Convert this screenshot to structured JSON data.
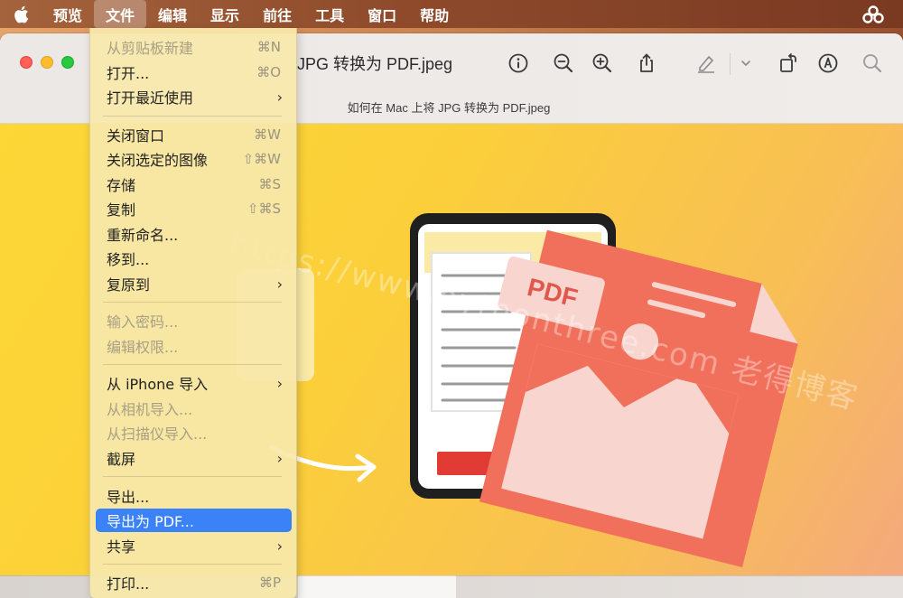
{
  "menubar": {
    "items": [
      {
        "label": "预览"
      },
      {
        "label": "文件"
      },
      {
        "label": "编辑"
      },
      {
        "label": "显示"
      },
      {
        "label": "前往"
      },
      {
        "label": "工具"
      },
      {
        "label": "窗口"
      },
      {
        "label": "帮助"
      }
    ],
    "active_index": 1,
    "icons": [
      "apple-icon",
      "creative-cloud-icon"
    ]
  },
  "window": {
    "title": "JPG 转换为 PDF.jpeg",
    "subtitle": "如何在 Mac 上将 JPG 转换为 PDF.jpeg",
    "toolbar_icons": [
      "info-icon",
      "zoom-out-icon",
      "zoom-in-icon",
      "share-icon",
      "highlight-icon",
      "chevron-down-icon",
      "rotate-icon",
      "markup-icon",
      "search-icon"
    ]
  },
  "image": {
    "badge_text": "PDF",
    "watermark": "https://www.pythonthree.com 老得博客"
  },
  "file_menu": {
    "items": [
      {
        "label": "从剪贴板新建",
        "shortcut": "⌘N",
        "disabled": true
      },
      {
        "label": "打开...",
        "shortcut": "⌘O",
        "disabled": false
      },
      {
        "label": "打开最近使用",
        "submenu": true,
        "disabled": false
      },
      {
        "label": "关闭窗口",
        "shortcut": "⌘W",
        "disabled": false
      },
      {
        "label": "关闭选定的图像",
        "shortcut": "⇧⌘W",
        "disabled": false
      },
      {
        "label": "存储",
        "shortcut": "⌘S",
        "disabled": false
      },
      {
        "label": "复制",
        "shortcut": "⇧⌘S",
        "disabled": false
      },
      {
        "label": "重新命名...",
        "disabled": false
      },
      {
        "label": "移到...",
        "disabled": false
      },
      {
        "label": "复原到",
        "submenu": true,
        "disabled": false
      },
      {
        "label": "输入密码...",
        "disabled": true
      },
      {
        "label": "编辑权限...",
        "disabled": true
      },
      {
        "label": "从 iPhone 导入",
        "submenu": true,
        "disabled": false
      },
      {
        "label": "从相机导入...",
        "disabled": true
      },
      {
        "label": "从扫描仪导入...",
        "disabled": true
      },
      {
        "label": "截屏",
        "submenu": true,
        "disabled": false
      },
      {
        "label": "导出...",
        "disabled": false
      },
      {
        "label": "导出为 PDF...",
        "disabled": false,
        "selected": true
      },
      {
        "label": "共享",
        "submenu": true,
        "disabled": false
      },
      {
        "label": "打印...",
        "shortcut": "⌘P",
        "disabled": false
      }
    ],
    "selected_color": "#3b82f6"
  },
  "colors": {
    "menubar": "#8e4a2b",
    "highlight": "#3b82f6",
    "image_yellow": "#fcd735",
    "pdf_red": "#f1705b"
  }
}
